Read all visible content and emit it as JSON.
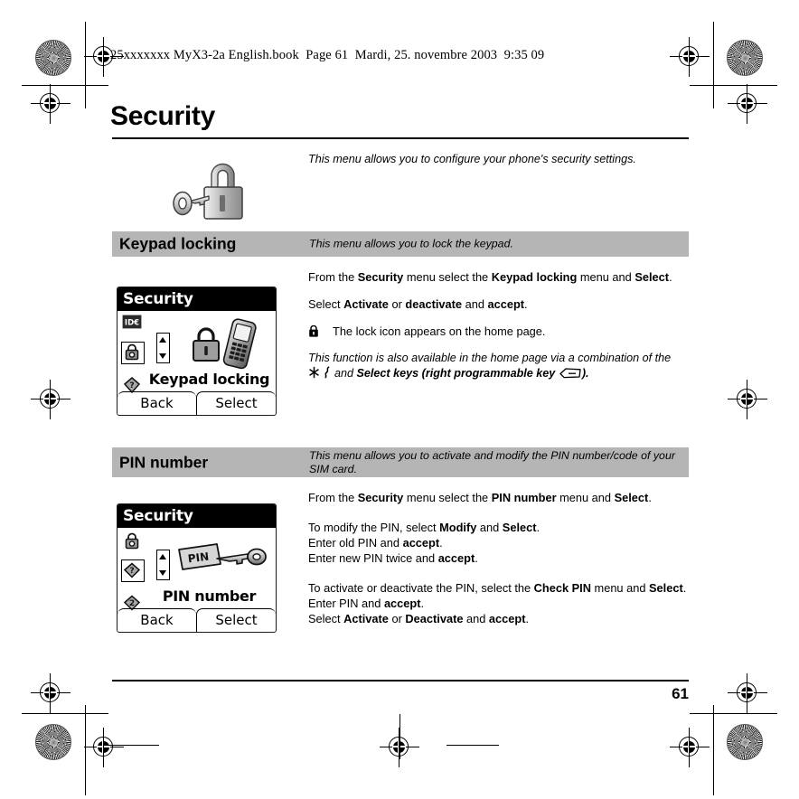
{
  "slug": "25xxxxxxx MyX3-2a English.book  Page 61  Mardi, 25. novembre 2003  9:35 09",
  "page": {
    "title": "Security",
    "intro": "This menu allows you to configure your phone's security settings.",
    "hero_icon": "padlock-and-key-icon",
    "folio": "61"
  },
  "sections": [
    {
      "id": "keypad-locking",
      "title": "Keypad locking",
      "description": "This menu allows you to lock the keypad.",
      "screenshot": {
        "titlebar": "Security",
        "menu_label": "Keypad locking",
        "hero_icon": "phone-with-padlock-icon",
        "softkey_left": "Back",
        "softkey_right": "Select",
        "rail_icons": [
          "id-card-icon",
          "keypad-lock-icon",
          "question-tag-icon"
        ]
      },
      "body": {
        "line1": {
          "pre": "From the ",
          "b1": "Security",
          "mid": " menu select the ",
          "b2": "Keypad locking",
          "mid2": " menu and ",
          "b3": "Select",
          "post": "."
        },
        "line2": {
          "pre": "Select ",
          "b1": "Activate",
          "mid": " or ",
          "b2": "deactivate",
          "mid2": " and ",
          "b3": "accept",
          "post": "."
        },
        "note": "The lock icon appears on the home page.",
        "note_icon": "lock-icon",
        "italic_note": {
          "l1": "This function is also available in the home page via a combination of the",
          "key_star": "star-key-icon",
          "key_silent": "silent-mode-key-icon",
          "l2_and": " and ",
          "l2_bold": "Select keys (right programmable key",
          "key_soft": "right-programmable-key-icon",
          "l2_close": ")."
        }
      }
    },
    {
      "id": "pin-number",
      "title": "PIN number",
      "description": "This menu allows you to activate and modify the PIN number/code of your SIM card.",
      "screenshot": {
        "titlebar": "Security",
        "menu_label": "PIN number",
        "hero_icon": "pin-tag-and-key-icon",
        "softkey_left": "Back",
        "softkey_right": "Select",
        "rail_icons": [
          "keypad-lock-icon",
          "question-tag-icon",
          "pin2-tag-icon"
        ]
      },
      "body": {
        "line1": {
          "pre": "From the ",
          "b1": "Security",
          "mid": " menu select the ",
          "b2": "PIN number",
          "mid2": " menu and ",
          "b3": "Select",
          "post": "."
        },
        "p2_l1": {
          "pre": "To modify the PIN, select ",
          "b1": "Modify",
          "mid": " and ",
          "b2": "Select",
          "post": "."
        },
        "p2_l2": {
          "pre": "Enter old PIN and ",
          "b1": "accept",
          "post": "."
        },
        "p2_l3": {
          "pre": "Enter new PIN twice and ",
          "b1": "accept",
          "post": "."
        },
        "p3_l1": {
          "pre": "To activate or deactivate the PIN, select the ",
          "b1": "Check PIN",
          "mid": " menu and ",
          "b2": "Select",
          "post": "."
        },
        "p3_l2": {
          "pre": "Enter PIN and ",
          "b1": "accept",
          "post": "."
        },
        "p3_l3": {
          "pre": "Select ",
          "b1": "Activate",
          "mid": " or ",
          "b2": "Deactivate",
          "mid2": " and ",
          "b3": "accept",
          "post": "."
        }
      }
    }
  ],
  "colors": {
    "band": "#b5b5b5",
    "text": "#000000",
    "background": "#ffffff"
  }
}
